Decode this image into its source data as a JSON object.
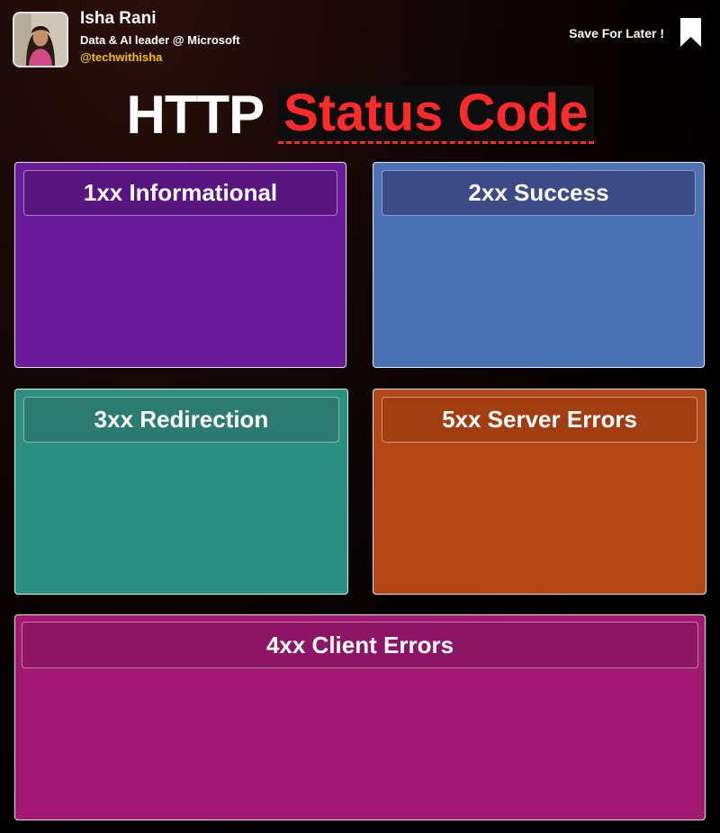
{
  "author": {
    "name": "Isha Rani",
    "title": "Data & AI leader @ Microsoft",
    "handle": "@techwithisha"
  },
  "save": {
    "label": "Save For Later !",
    "icon": "bookmark-icon"
  },
  "title": {
    "part1": "HTTP",
    "part2": "Status Code"
  },
  "cards": {
    "informational": {
      "label": "1xx Informational",
      "color": "#6a1b9a"
    },
    "success": {
      "label": "2xx Success",
      "color": "#4a72b5"
    },
    "redirection": {
      "label": "3xx Redirection",
      "color": "#2a9080"
    },
    "server_errors": {
      "label": "5xx Server Errors",
      "color": "#b44716"
    },
    "client_errors": {
      "label": "4xx Client Errors",
      "color": "#a01870"
    }
  },
  "colors": {
    "accent_red": "#ff2a2a",
    "handle_yellow": "#f2c200"
  }
}
